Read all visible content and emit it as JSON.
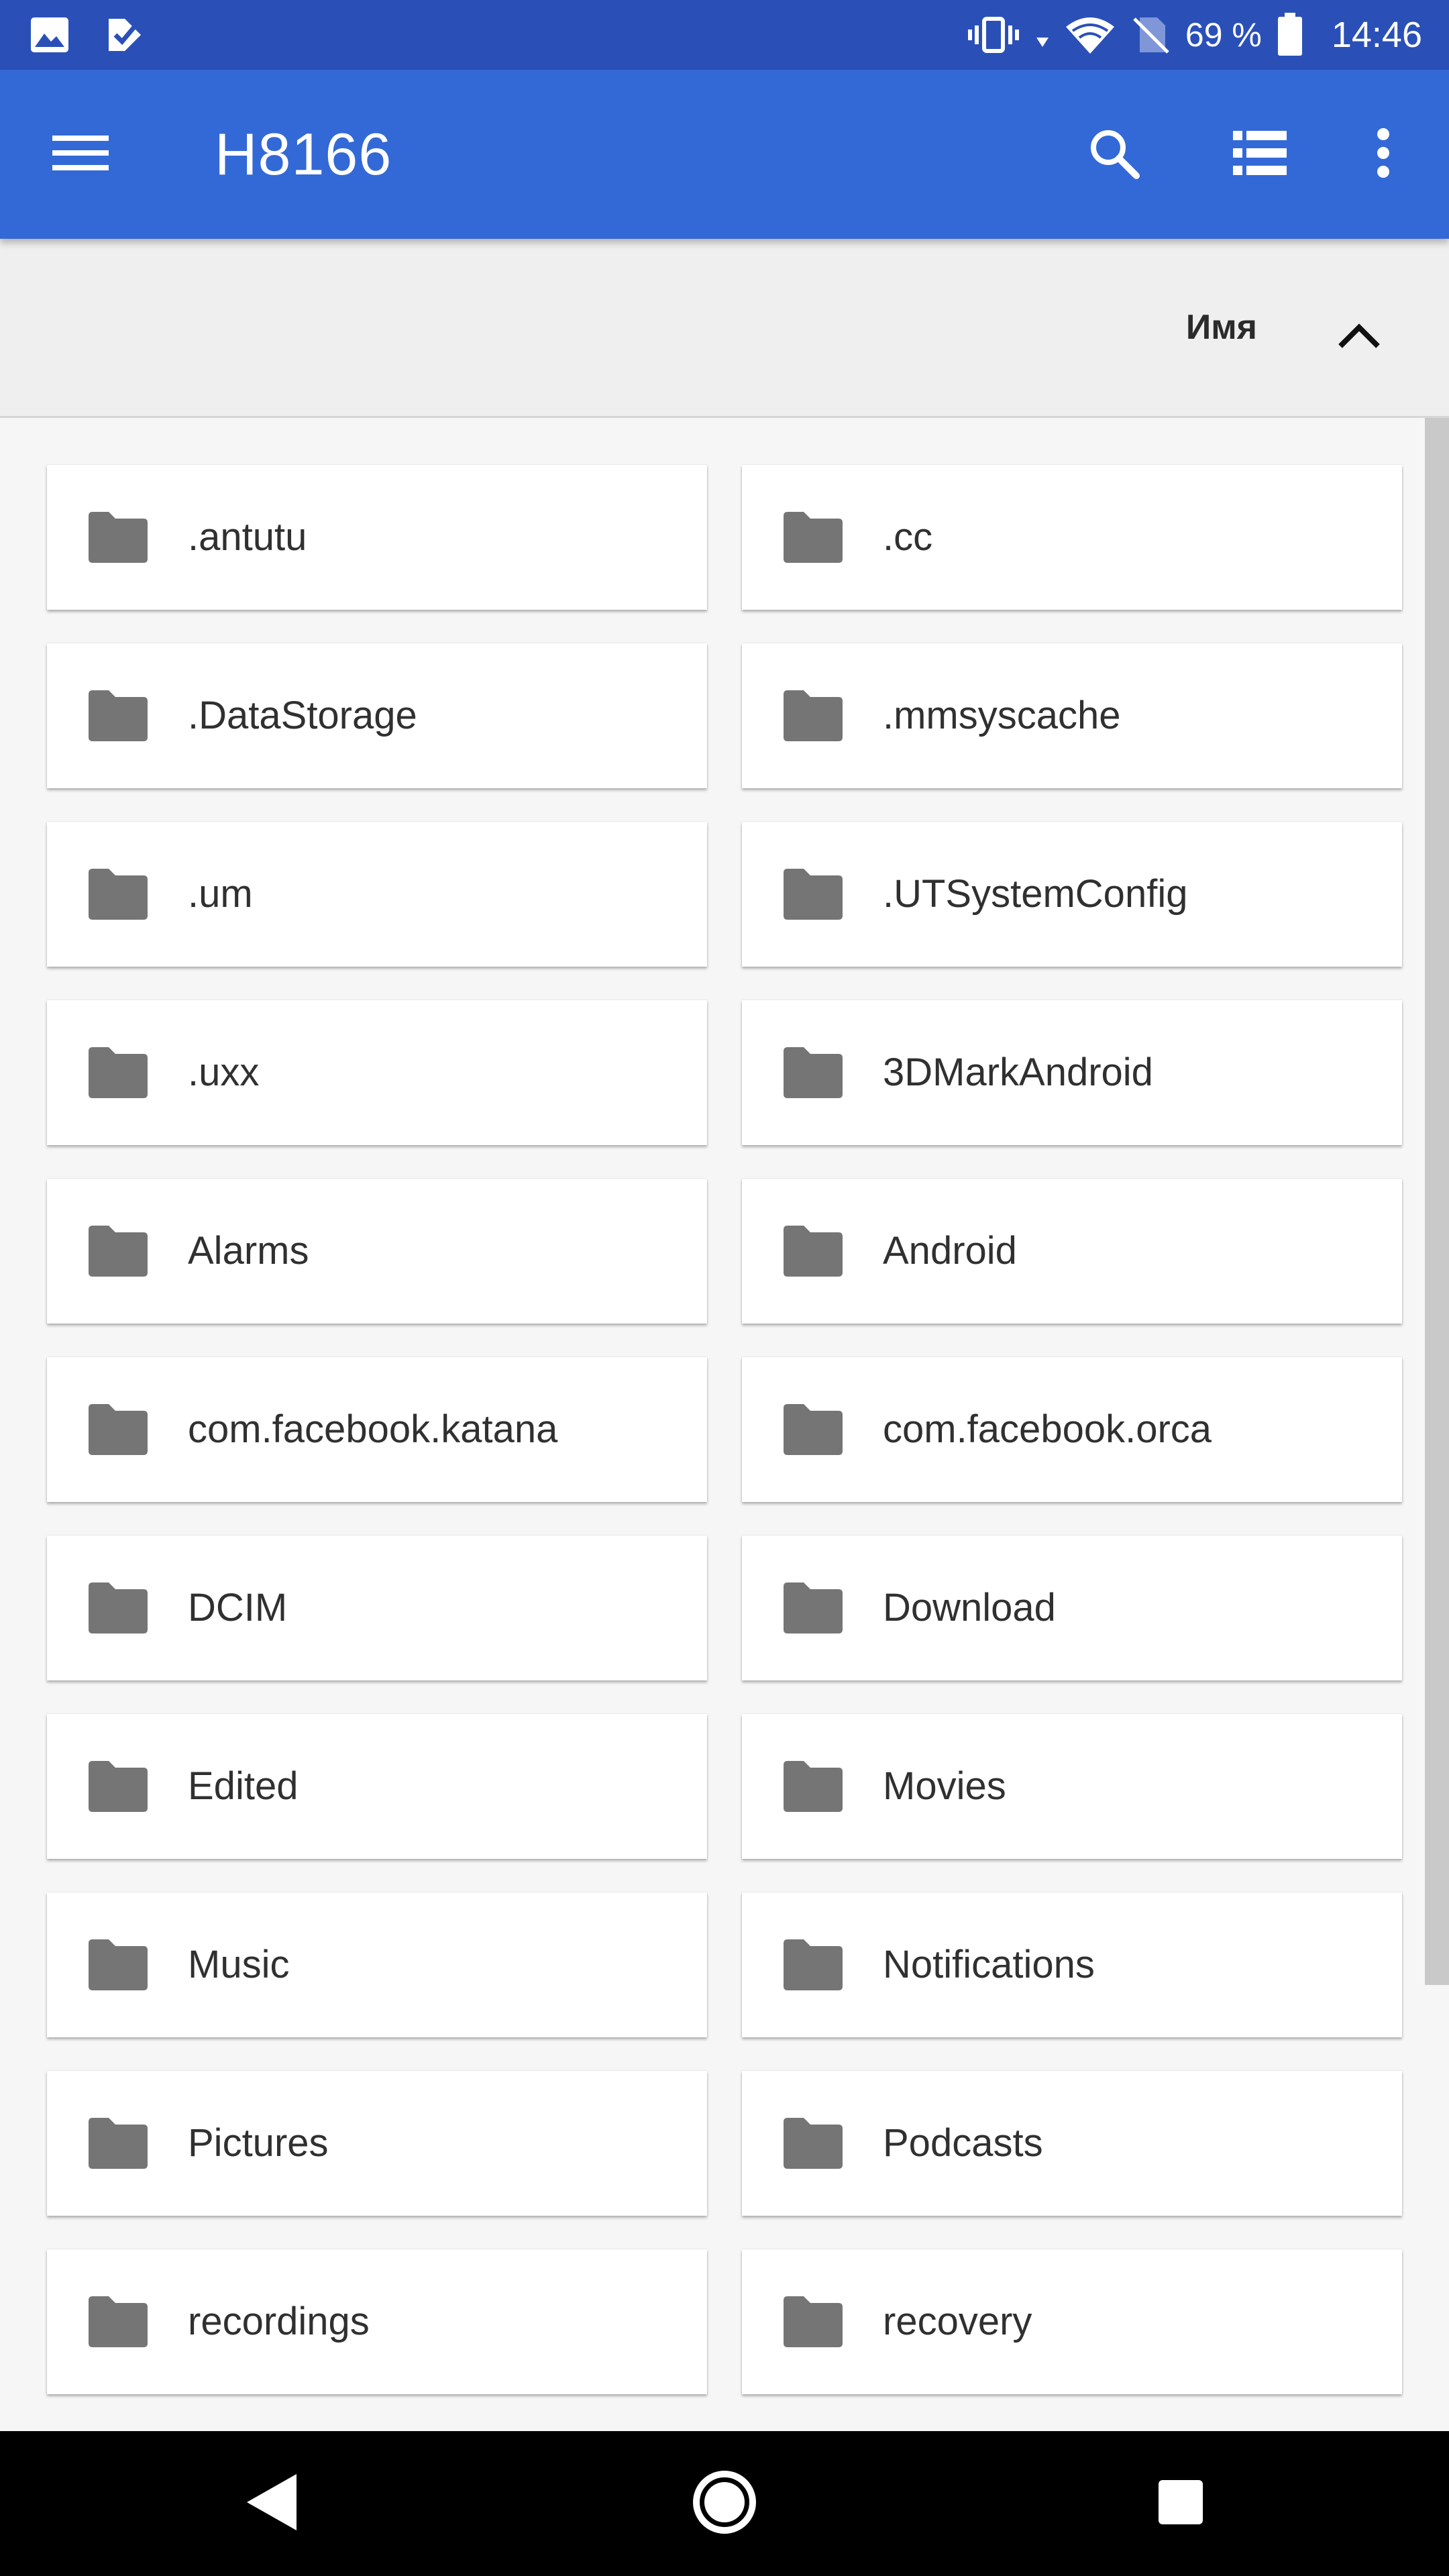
{
  "status_bar": {
    "battery_text": "69 %",
    "time": "14:46",
    "icons": [
      "gallery-icon",
      "checkmark-app-icon",
      "vibrate-icon",
      "data-arrow-icon",
      "wifi-icon",
      "no-sim-icon",
      "battery-icon"
    ]
  },
  "app_bar": {
    "title": "H8166",
    "icons": [
      "menu-icon",
      "search-icon",
      "list-view-icon",
      "more-vert-icon"
    ]
  },
  "sort": {
    "label": "Имя",
    "direction_icon": "chevron-up-icon"
  },
  "folders": [
    {
      "name": ".antutu"
    },
    {
      "name": ".cc"
    },
    {
      "name": ".DataStorage"
    },
    {
      "name": ".mmsyscache"
    },
    {
      "name": ".um"
    },
    {
      "name": ".UTSystemConfig"
    },
    {
      "name": ".uxx"
    },
    {
      "name": "3DMarkAndroid"
    },
    {
      "name": "Alarms"
    },
    {
      "name": "Android"
    },
    {
      "name": "com.facebook.katana"
    },
    {
      "name": "com.facebook.orca"
    },
    {
      "name": "DCIM"
    },
    {
      "name": "Download"
    },
    {
      "name": "Edited"
    },
    {
      "name": "Movies"
    },
    {
      "name": "Music"
    },
    {
      "name": "Notifications"
    },
    {
      "name": "Pictures"
    },
    {
      "name": "Podcasts"
    },
    {
      "name": "recordings"
    },
    {
      "name": "recovery"
    }
  ],
  "nav_bar": {
    "icons": [
      "back-icon",
      "home-icon",
      "recents-icon"
    ]
  },
  "colors": {
    "status_bar": "#2a50b8",
    "app_bar": "#3369d6",
    "folder_icon": "#757575",
    "background": "#f6f6f6"
  }
}
